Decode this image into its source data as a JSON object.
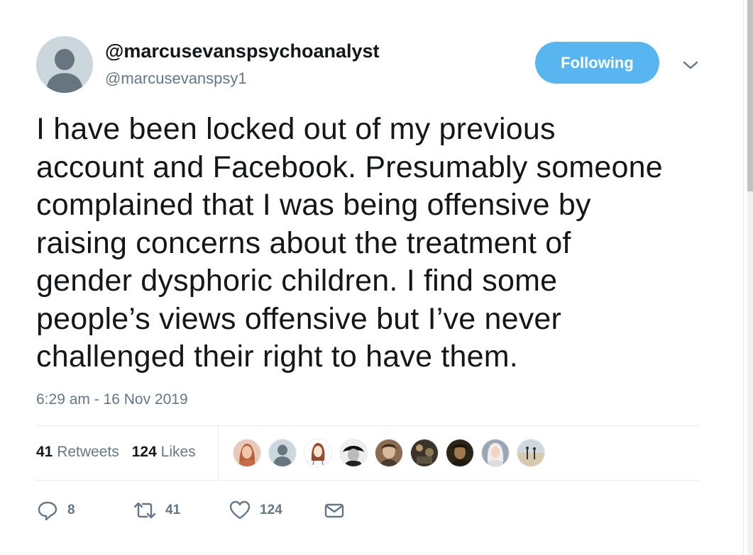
{
  "user": {
    "display_name": "@marcusevanspsychoanalyst",
    "handle": "@marcusevanspsy1"
  },
  "follow_button": {
    "label": "Following",
    "color": "#58b5f0"
  },
  "tweet": {
    "text": "I have been locked out of my previous\naccount and Facebook. Presumably someone\ncomplained that I was being offensive by\nraising concerns about the treatment of\ngender dysphoric children. I find some\npeople’s views offensive but I’ve never\nchallenged their right to have them.",
    "timestamp": "6:29 am - 16 Nov 2019"
  },
  "stats": {
    "retweets_count": "41",
    "retweets_label": "Retweets",
    "likes_count": "124",
    "likes_label": "Likes"
  },
  "likers": [
    {
      "icon": "liker-avatar-1"
    },
    {
      "icon": "liker-avatar-2-default"
    },
    {
      "icon": "liker-avatar-3-drawing"
    },
    {
      "icon": "liker-avatar-4"
    },
    {
      "icon": "liker-avatar-5"
    },
    {
      "icon": "liker-avatar-6"
    },
    {
      "icon": "liker-avatar-7"
    },
    {
      "icon": "liker-avatar-8"
    },
    {
      "icon": "liker-avatar-9"
    }
  ],
  "actions": {
    "reply_count": "8",
    "retweet_count": "41",
    "like_count": "124",
    "icons": [
      "reply-icon",
      "retweet-icon",
      "like-icon",
      "message-icon"
    ]
  }
}
